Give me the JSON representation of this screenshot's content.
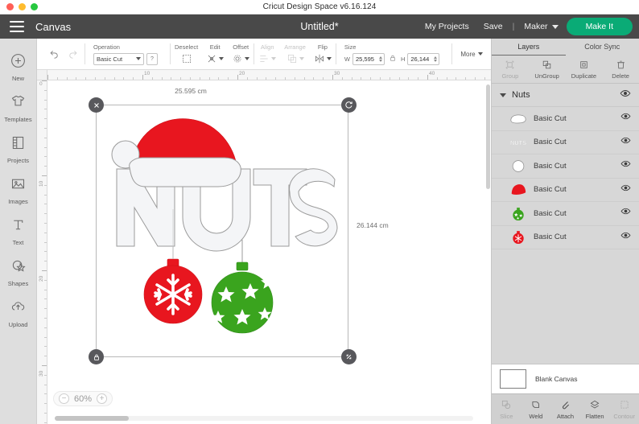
{
  "window": {
    "title": "Cricut Design Space  v6.16.124",
    "traffic_lights": [
      "close-button",
      "minimize-button",
      "zoom-button"
    ]
  },
  "header": {
    "menu_icon": "hamburger-icon",
    "canvas_label": "Canvas",
    "document_title": "Untitled*",
    "my_projects": "My Projects",
    "save": "Save",
    "separator": "|",
    "machine": "Maker",
    "make_it": "Make It",
    "accent_green": "#0aab76",
    "bar_color": "#494949"
  },
  "rail": {
    "items": [
      {
        "label": "New",
        "icon": "plus-circle-icon"
      },
      {
        "label": "Templates",
        "icon": "tshirt-icon"
      },
      {
        "label": "Projects",
        "icon": "book-icon"
      },
      {
        "label": "Images",
        "icon": "picture-icon"
      },
      {
        "label": "Text",
        "icon": "text-t-icon"
      },
      {
        "label": "Shapes",
        "icon": "shapes-icon"
      },
      {
        "label": "Upload",
        "icon": "upload-cloud-icon"
      }
    ]
  },
  "toolbar": {
    "undo": "undo-icon",
    "redo": "redo-icon",
    "operation_label": "Operation",
    "operation_value": "Basic Cut",
    "help_label": "?",
    "deselect_label": "Deselect",
    "edit_label": "Edit",
    "offset_label": "Offset",
    "align_label": "Align",
    "arrange_label": "Arrange",
    "flip_label": "Flip",
    "size_label": "Size",
    "width_label": "W",
    "width_value": "25,595",
    "height_label": "H",
    "height_value": "26,144",
    "lock_icon": "lock-icon",
    "more_label": "More"
  },
  "canvas": {
    "ruler_h_labels": [
      "10",
      "20",
      "30",
      "40"
    ],
    "ruler_v_labels": [
      "0",
      "10",
      "20",
      "30"
    ],
    "origin_label": "0",
    "width_dimension": "25.595 cm",
    "height_dimension": "26.144 cm",
    "delete_handle": "close-icon",
    "rotate_handle": "rotate-icon",
    "lock_handle": "lock-icon",
    "resize_handle": "resize-icon",
    "zoom_out": "minus-icon",
    "zoom_in": "plus-icon",
    "zoom_level": "60%"
  },
  "artwork": {
    "word": "NUTS",
    "red": "#e8161f",
    "green": "#3aa41e",
    "white": "#f4f5f7",
    "outline": "#9a9a9a"
  },
  "right_panel": {
    "tabs": [
      {
        "label": "Layers",
        "active": true
      },
      {
        "label": "Color Sync",
        "active": false
      }
    ],
    "actions": [
      {
        "label": "Group",
        "icon": "group-icon",
        "disabled": true
      },
      {
        "label": "UnGroup",
        "icon": "ungroup-icon",
        "disabled": false
      },
      {
        "label": "Duplicate",
        "icon": "duplicate-icon",
        "disabled": false
      },
      {
        "label": "Delete",
        "icon": "trash-icon",
        "disabled": false
      }
    ],
    "group": {
      "name": "Nuts",
      "visibility_icon": "eye-icon"
    },
    "layers": [
      {
        "label": "Basic Cut",
        "thumb": "hat-brim-thumb"
      },
      {
        "label": "Basic Cut",
        "thumb": "nuts-text-thumb"
      },
      {
        "label": "Basic Cut",
        "thumb": "pompom-thumb"
      },
      {
        "label": "Basic Cut",
        "thumb": "santa-hat-thumb"
      },
      {
        "label": "Basic Cut",
        "thumb": "green-ornament-thumb"
      },
      {
        "label": "Basic Cut",
        "thumb": "red-ornament-thumb"
      }
    ],
    "blank_canvas": "Blank Canvas",
    "bottom_actions": [
      {
        "label": "Slice",
        "icon": "slice-icon",
        "disabled": true
      },
      {
        "label": "Weld",
        "icon": "weld-icon",
        "disabled": false
      },
      {
        "label": "Attach",
        "icon": "attach-icon",
        "disabled": false
      },
      {
        "label": "Flatten",
        "icon": "flatten-icon",
        "disabled": false
      },
      {
        "label": "Contour",
        "icon": "contour-icon",
        "disabled": true
      }
    ]
  }
}
